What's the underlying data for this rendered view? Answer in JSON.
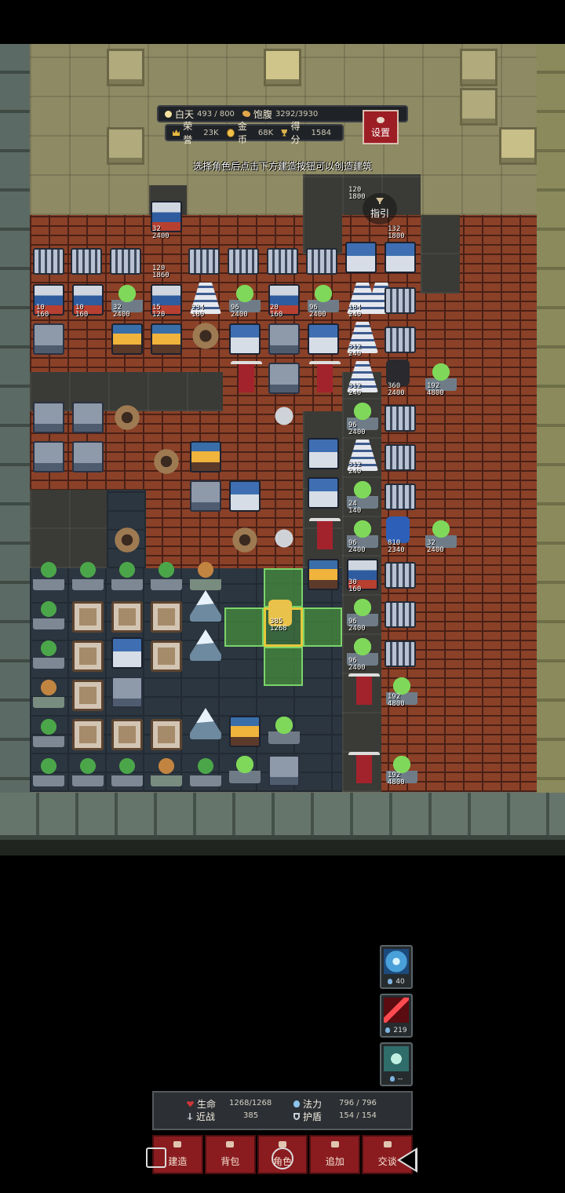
{
  "hud": {
    "day_label": "白天",
    "day_value": "493 / 800",
    "food_label": "饱腹",
    "food_value": "3292/3930",
    "honor_label": "荣誉",
    "honor_value": "23K",
    "gold_label": "金币",
    "gold_value": "68K",
    "score_label": "得分",
    "score_value": "1584",
    "settings_label": "设置"
  },
  "hint_text": "选择角色后点击下方建造按钮可以创造建筑",
  "guide_label": "指引",
  "units": [
    {
      "hp": "120",
      "max": "1800"
    },
    {
      "hp": "32",
      "max": "2400"
    },
    {
      "hp": "120",
      "max": "1860"
    },
    {
      "hp": "132",
      "max": "1800"
    },
    {
      "hp": "10",
      "max": "160"
    },
    {
      "hp": "10",
      "max": "160"
    },
    {
      "hp": "32",
      "max": "2400"
    },
    {
      "hp": "15",
      "max": "120"
    },
    {
      "hp": "234",
      "max": "180"
    },
    {
      "hp": "96",
      "max": "2400"
    },
    {
      "hp": "20",
      "max": "160"
    },
    {
      "hp": "96",
      "max": "2400"
    },
    {
      "hp": "184",
      "max": "240"
    },
    {
      "hp": "312",
      "max": "240"
    },
    {
      "hp": "312",
      "max": "240"
    },
    {
      "hp": "360",
      "max": "2400"
    },
    {
      "hp": "192",
      "max": "4800"
    },
    {
      "hp": "96",
      "max": "2400"
    },
    {
      "hp": "312",
      "max": "240"
    },
    {
      "hp": "24",
      "max": "140"
    },
    {
      "hp": "96",
      "max": "2400"
    },
    {
      "hp": "810",
      "max": "2340"
    },
    {
      "hp": "32",
      "max": "2400"
    },
    {
      "hp": "30",
      "max": "160"
    },
    {
      "hp": "385",
      "max": "1268"
    },
    {
      "hp": "96",
      "max": "2400"
    },
    {
      "hp": "96",
      "max": "2400"
    },
    {
      "hp": "192",
      "max": "4800"
    },
    {
      "hp": "192",
      "max": "4800"
    }
  ],
  "skills": [
    {
      "name": "ice-rune",
      "cost": "40"
    },
    {
      "name": "blood-blade",
      "cost": "219"
    },
    {
      "name": "shield-rune",
      "cost": "--"
    }
  ],
  "stats": {
    "hp_label": "生命",
    "hp_value": "1268/1268",
    "mana_label": "法力",
    "mana_value": "796 / 796",
    "melee_label": "近战",
    "melee_value": "385",
    "shield_label": "护盾",
    "shield_value": "154 / 154"
  },
  "menu": [
    "建造",
    "背包",
    "角色",
    "追加",
    "交谈"
  ]
}
